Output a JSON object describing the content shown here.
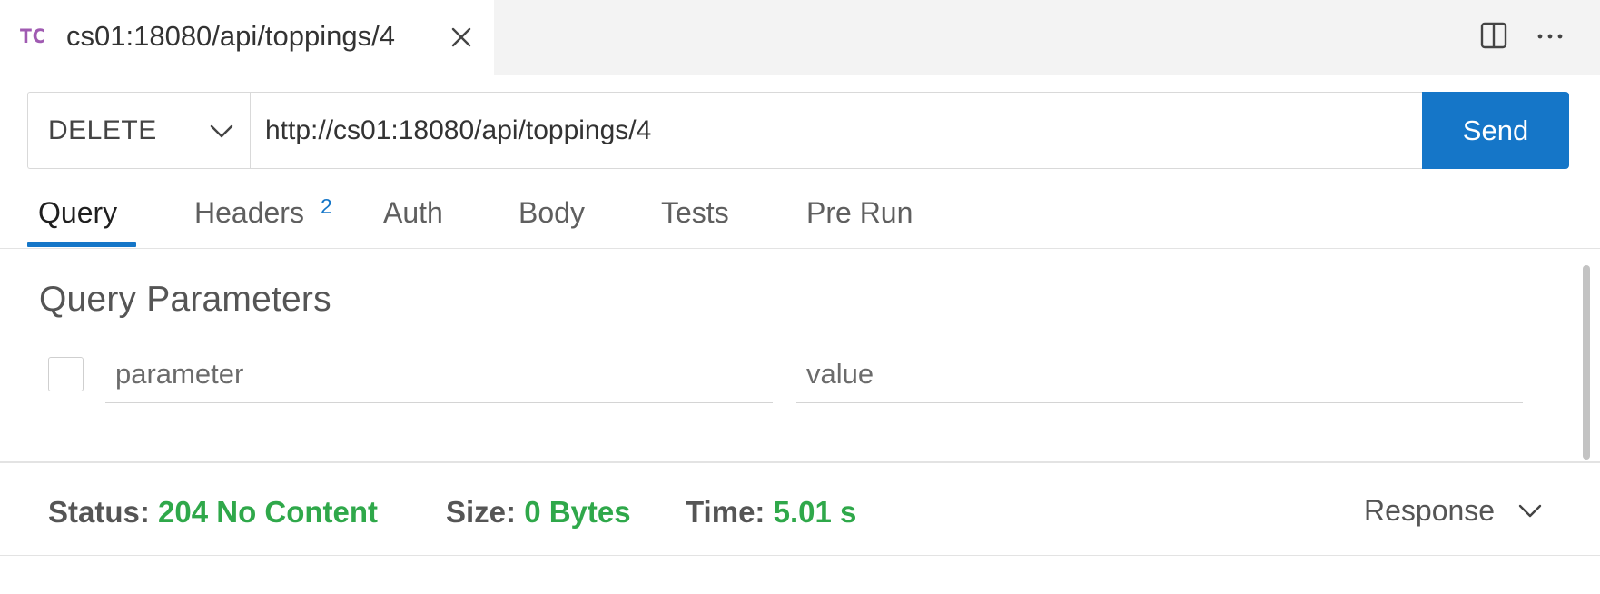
{
  "tab": {
    "badge": "TC",
    "title": "cs01:18080/api/toppings/4",
    "badge_color": "#a05bb2"
  },
  "tabbar_actions": {
    "split_icon": "split-editor-icon",
    "more_icon": "more-actions-icon"
  },
  "request": {
    "method": "DELETE",
    "url": "http://cs01:18080/api/toppings/4",
    "send_label": "Send",
    "accent_color": "#1576c8"
  },
  "request_tabs": [
    {
      "label": "Query",
      "active": true
    },
    {
      "label": "Headers",
      "count": "2"
    },
    {
      "label": "Auth"
    },
    {
      "label": "Body"
    },
    {
      "label": "Tests"
    },
    {
      "label": "Pre Run"
    }
  ],
  "query": {
    "title": "Query Parameters",
    "param_placeholder": "parameter",
    "value_placeholder": "value"
  },
  "status": {
    "status_label": "Status:",
    "status_value": "204 No Content",
    "size_label": "Size:",
    "size_value": "0 Bytes",
    "time_label": "Time:",
    "time_value": "5.01 s",
    "response_label": "Response",
    "success_color": "#2fa84a"
  }
}
